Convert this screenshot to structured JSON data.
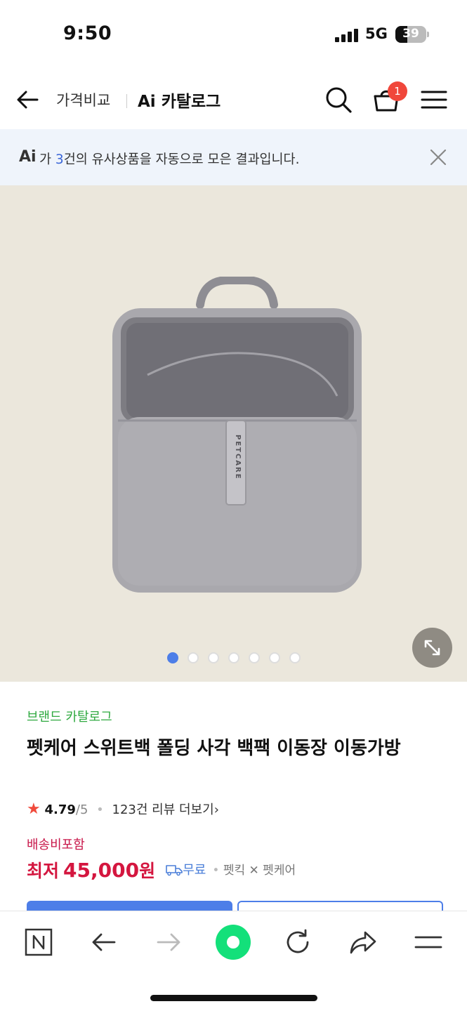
{
  "status_bar": {
    "time": "9:50",
    "network": "5G",
    "battery": "39",
    "battery_level": 0.39
  },
  "header": {
    "compare_label": "가격비교",
    "title": "Ai 카탈로그",
    "cart_count": "1"
  },
  "ai_banner": {
    "logo": "Ai",
    "text_prefix": "가 ",
    "count": "3",
    "text_suffix": "건의 유사상품을 자동으로 모은 결과입니다."
  },
  "hero": {
    "bag_label": "PETCARE",
    "page_count": 7,
    "active_index": 0
  },
  "product": {
    "brand_link": "브랜드 카탈로그",
    "title": "펫케어 스위트백 폴딩 사각 백팩 이동장 이동가방",
    "rating_star": "★",
    "rating": "4.79",
    "rating_max": "/5",
    "reviews": "123건 리뷰 더보기",
    "reviews_chevron": "›",
    "shipping_note": "배송비포함",
    "price_label": "최저",
    "price": "45,000",
    "price_unit": "원",
    "free_shipping": "무료",
    "seller": "펫킥 ✕ 펫케어"
  },
  "colors": {
    "accent_blue": "#4d7ee8",
    "price_red": "#d4163f",
    "brand_green": "#2fa940",
    "badge_red": "#f0473b",
    "hero_bg": "#ebe7dc"
  }
}
